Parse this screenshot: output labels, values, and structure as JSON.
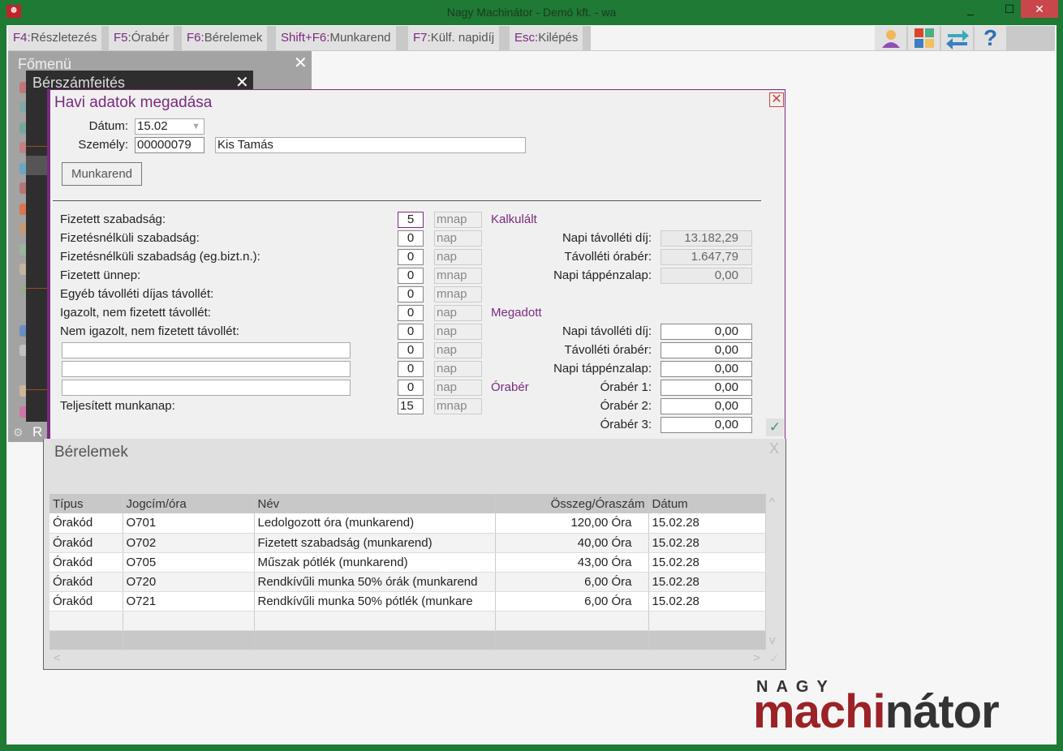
{
  "window": {
    "title": "Nagy Machinátor - Demó kft. - wa",
    "minimize": "_",
    "maximize": "☐",
    "close": "✕"
  },
  "toolbar": {
    "items": [
      {
        "key": "F4:",
        "label": "Részletezés"
      },
      {
        "key": "F5:",
        "label": "Órabér"
      },
      {
        "key": "F6:",
        "label": "Bérelemek"
      },
      {
        "key": "Shift+F6:",
        "label": "Munkarend"
      },
      {
        "key": "F7:",
        "label": "Külf. napidíj"
      },
      {
        "key": "Esc:",
        "label": "Kilépés"
      }
    ],
    "icons": [
      "user-icon",
      "tiles-icon",
      "swap-arrows-icon",
      "help-icon"
    ],
    "help_glyph": "?"
  },
  "fomenu": {
    "title": "Főmenü",
    "close": "✕",
    "footer": "R"
  },
  "berszamfeites": {
    "title": "Bérszámfeités",
    "close": "✕"
  },
  "dialog": {
    "title": "Havi adatok megadása",
    "close": "✕",
    "datum_label": "Dátum:",
    "datum_value": "15.02",
    "szemely_label": "Személy:",
    "szemely_id": "00000079",
    "szemely_name": "Kis Tamás",
    "munkarend_button": "Munkarend",
    "rows": [
      {
        "label": "Fizetett szabadság:",
        "value": "5",
        "unit": "mnap"
      },
      {
        "label": "Fizetésnélküli szabadság:",
        "value": "0",
        "unit": "nap"
      },
      {
        "label": "Fizetésnélküli szabadság (eg.bizt.n.):",
        "value": "0",
        "unit": "nap"
      },
      {
        "label": "Fizetett ünnep:",
        "value": "0",
        "unit": "mnap"
      },
      {
        "label": "Egyéb távolléti díjas távollét:",
        "value": "0",
        "unit": "mnap"
      },
      {
        "label": "Igazolt, nem fizetett távollét:",
        "value": "0",
        "unit": "nap"
      },
      {
        "label": "Nem igazolt, nem fizetett távollét:",
        "value": "0",
        "unit": "nap"
      },
      {
        "label": "",
        "value": "0",
        "unit": "nap"
      },
      {
        "label": "",
        "value": "0",
        "unit": "nap"
      },
      {
        "label": "",
        "value": "0",
        "unit": "nap"
      },
      {
        "label": "Teljesített munkanap:",
        "value": "15",
        "unit": "mnap"
      }
    ],
    "kalkulalt": {
      "title": "Kalkulált",
      "fields": [
        {
          "label": "Napi távolléti díj:",
          "value": "13.182,29"
        },
        {
          "label": "Távolléti órabér:",
          "value": "1.647,79"
        },
        {
          "label": "Napi táppénzalap:",
          "value": "0,00"
        }
      ]
    },
    "megadott": {
      "title": "Megadott",
      "fields": [
        {
          "label": "Napi távolléti díj:",
          "value": "0,00"
        },
        {
          "label": "Távolléti órabér:",
          "value": "0,00"
        },
        {
          "label": "Napi táppénzalap:",
          "value": "0,00"
        }
      ]
    },
    "oraber": {
      "title": "Órabér",
      "fields": [
        {
          "label": "Órabér 1:",
          "value": "0,00"
        },
        {
          "label": "Órabér 2:",
          "value": "0,00"
        },
        {
          "label": "Órabér 3:",
          "value": "0,00"
        }
      ]
    },
    "ok": "✓"
  },
  "berelemek": {
    "title": "Bérelemek",
    "close": "X",
    "columns": [
      "Típus",
      "Jogcím/óra",
      "Név",
      "Összeg/Óraszám",
      "Dátum"
    ],
    "rows": [
      [
        "Órakód",
        "O701",
        "Ledolgozott óra (munkarend)",
        "120,00 Óra",
        "15.02.28"
      ],
      [
        "Órakód",
        "O702",
        "Fizetett szabadság (munkarend)",
        "40,00 Óra",
        "15.02.28"
      ],
      [
        "Órakód",
        "O705",
        "Műszak pótlék (munkarend)",
        "43,00 Óra",
        "15.02.28"
      ],
      [
        "Órakód",
        "O720",
        "Rendkívűli munka 50% órák (munkarend",
        "6,00 Óra",
        "15.02.28"
      ],
      [
        "Órakód",
        "O721",
        "Rendkívűli munka 50% pótlék  (munkare",
        "6,00 Óra",
        "15.02.28"
      ]
    ],
    "scroll_up": "^",
    "scroll_down": "v",
    "scroll_left": "<",
    "scroll_right": ">",
    "ok": "✓"
  },
  "logo": {
    "top": "NAGY",
    "red": "machi",
    "dark": "nátor"
  },
  "colors": {
    "frame": "#1e7a34",
    "accent": "#7a2a7f",
    "logo_red": "#9b2226"
  }
}
